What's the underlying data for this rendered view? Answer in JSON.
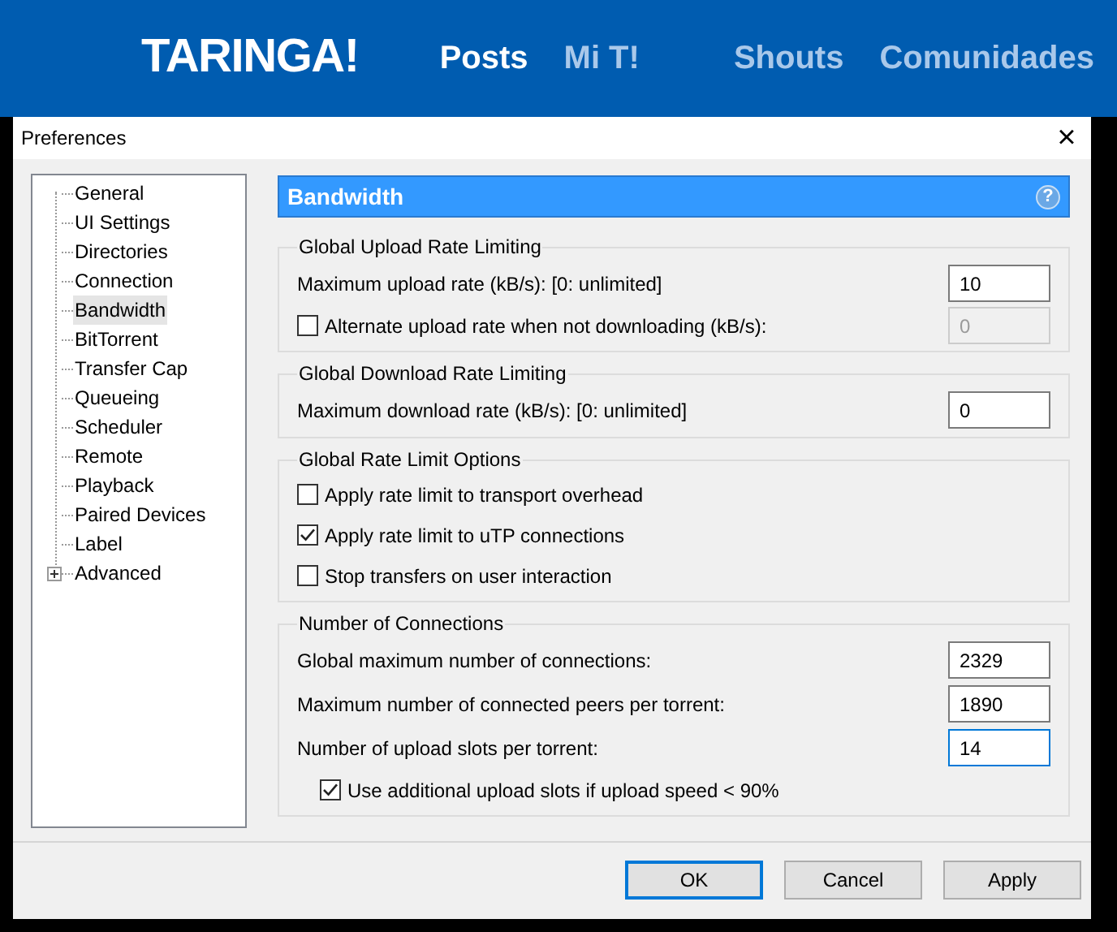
{
  "site_header": {
    "logo": "TARINGA!",
    "nav": [
      {
        "label": "Posts",
        "selected": true
      },
      {
        "label": "Mi T!",
        "selected": false
      },
      {
        "label": "Shouts",
        "selected": false
      },
      {
        "label": "Comunidades",
        "selected": false
      }
    ]
  },
  "window": {
    "title": "Preferences",
    "close": "×"
  },
  "tree": [
    {
      "label": "General",
      "selected": false
    },
    {
      "label": "UI Settings",
      "selected": false
    },
    {
      "label": "Directories",
      "selected": false
    },
    {
      "label": "Connection",
      "selected": false
    },
    {
      "label": "Bandwidth",
      "selected": true
    },
    {
      "label": "BitTorrent",
      "selected": false
    },
    {
      "label": "Transfer Cap",
      "selected": false
    },
    {
      "label": "Queueing",
      "selected": false
    },
    {
      "label": "Scheduler",
      "selected": false
    },
    {
      "label": "Remote",
      "selected": false
    },
    {
      "label": "Playback",
      "selected": false
    },
    {
      "label": "Paired Devices",
      "selected": false
    },
    {
      "label": "Label",
      "selected": false
    },
    {
      "label": "Advanced",
      "selected": false,
      "expandable": true,
      "expanded": false
    }
  ],
  "panel": {
    "title": "Bandwidth",
    "help": "?"
  },
  "sections": [
    {
      "title": "Global Upload Rate Limiting",
      "rows": [
        {
          "kind": "input",
          "label": "Maximum upload rate (kB/s): [0: unlimited]",
          "value": "10",
          "disabled": false,
          "focused": false
        },
        {
          "kind": "checkbox",
          "label": "Alternate upload rate when not downloading (kB/s):",
          "checked": false,
          "value": "0",
          "disabled": true,
          "focused": false
        }
      ]
    },
    {
      "title": "Global Download Rate Limiting",
      "rows": [
        {
          "kind": "input",
          "label": "Maximum download rate (kB/s): [0: unlimited]",
          "value": "0",
          "disabled": false,
          "focused": false
        }
      ]
    },
    {
      "title": "Global Rate Limit Options",
      "rows": [
        {
          "kind": "checkbox",
          "label": "Apply rate limit to transport overhead",
          "checked": false
        },
        {
          "kind": "checkbox",
          "label": "Apply rate limit to uTP connections",
          "checked": true
        },
        {
          "kind": "checkbox",
          "label": "Stop transfers on user interaction",
          "checked": false
        }
      ]
    },
    {
      "title": "Number of Connections",
      "rows": [
        {
          "kind": "input",
          "label": "Global maximum number of connections:",
          "value": "2329",
          "disabled": false,
          "focused": false
        },
        {
          "kind": "input",
          "label": "Maximum number of connected peers per torrent:",
          "value": "1890",
          "disabled": false,
          "focused": false
        },
        {
          "kind": "input",
          "label": "Number of upload slots per torrent:",
          "value": "14",
          "disabled": false,
          "focused": true
        },
        {
          "kind": "sub_checkbox",
          "label": "Use additional upload slots if upload speed < 90%",
          "checked": true
        }
      ]
    }
  ],
  "buttons": [
    {
      "label": "OK",
      "default": true
    },
    {
      "label": "Cancel",
      "default": false
    },
    {
      "label": "Apply",
      "default": false
    }
  ]
}
